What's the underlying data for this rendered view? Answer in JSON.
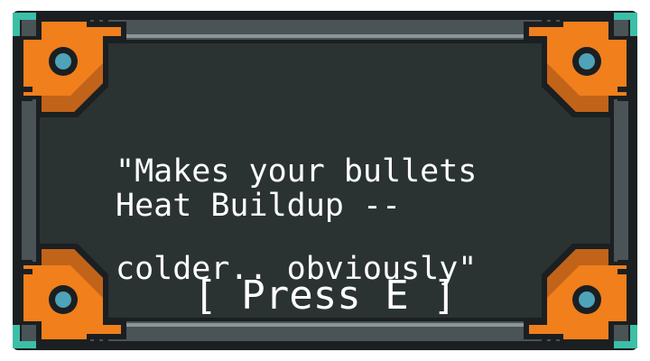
{
  "colors": {
    "panel_bg": "#2b3232",
    "panel_border": "#4a5356",
    "frame_dark": "#1b1f21",
    "trim_light": "#8a9699",
    "corner_orange": "#f07f1c",
    "corner_orange_dark": "#c2631a",
    "corner_teal": "#3bbfa6",
    "bolt_blue": "#4fa3b8",
    "text": "#ffffff"
  },
  "item_card": {
    "description_lines": [
      "\"Makes your bullets",
      "colder.. obviously\""
    ],
    "stat_text": "Heat Buildup --",
    "prompt_text": "[ Press E ]"
  },
  "icons": {
    "corner_bolt": "bolt-icon"
  }
}
